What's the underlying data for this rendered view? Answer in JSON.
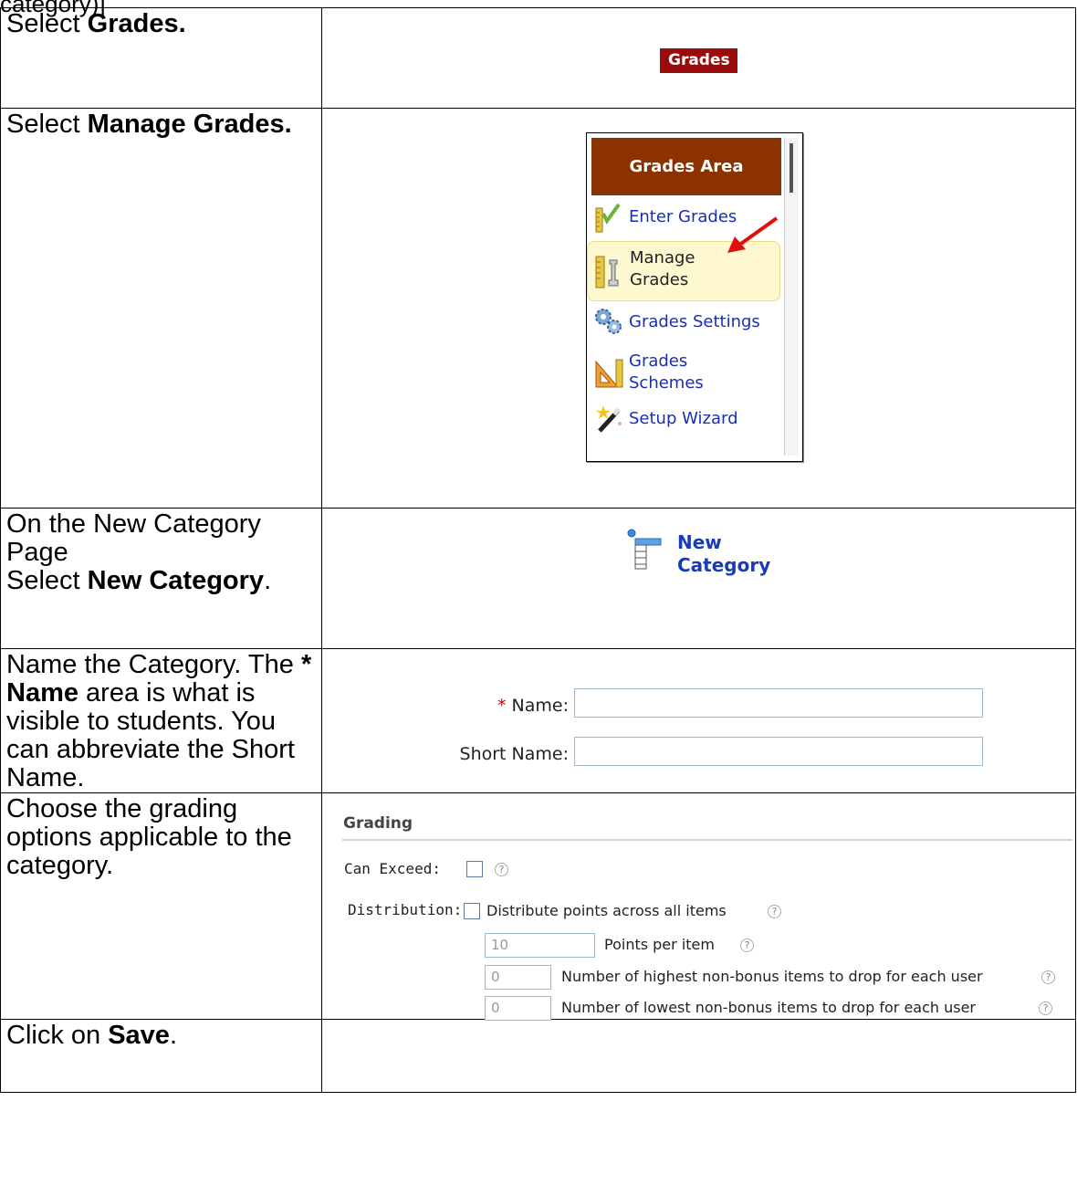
{
  "clipped_text": "category)]",
  "rows": [
    {
      "instruction": [
        "Select ",
        "Grades."
      ]
    },
    {
      "instruction": [
        "Select ",
        "Manage Grades."
      ]
    },
    {
      "instruction": [
        "On the New Category Page",
        "Select ",
        "New Category",
        "."
      ]
    },
    {
      "instruction": [
        "Name the Category. The ",
        "* Name",
        " area is what is visible to students.  You can abbreviate the Short Name."
      ]
    },
    {
      "instruction": [
        "Choose the grading options applicable to the category."
      ]
    },
    {
      "instruction": [
        "Click on ",
        "Save",
        "."
      ]
    }
  ],
  "grades_button": {
    "label": "Grades"
  },
  "grades_menu": {
    "header": "Grades Area",
    "items": [
      {
        "label": "Enter Grades",
        "icon": "ruler-check-icon"
      },
      {
        "label": "Manage Grades",
        "label_lines": [
          "Manage",
          "Grades"
        ],
        "icon": "ruler-tools-icon",
        "highlighted": true
      },
      {
        "label": "Grades Settings",
        "icon": "gears-icon"
      },
      {
        "label": "Grades Schemes",
        "label_lines": [
          "Grades",
          "Schemes"
        ],
        "icon": "triangle-ruler-icon"
      },
      {
        "label": "Setup Wizard",
        "icon": "magic-wand-icon"
      }
    ],
    "colors": {
      "header_bg": "#8b3200",
      "highlight_bg": "#fdf8cf",
      "link": "#1a2fb0"
    }
  },
  "new_category": {
    "label_lines": [
      "New",
      "Category"
    ],
    "icon": "new-category-icon"
  },
  "name_form": {
    "name_required_mark": "*",
    "name_label": "Name:",
    "short_name_label": "Short Name:",
    "name_value": "",
    "short_name_value": ""
  },
  "grading": {
    "title": "Grading",
    "can_exceed_label": "Can Exceed:",
    "can_exceed_checked": false,
    "distribution_label": "Distribution:",
    "distribute_label": "Distribute points across all items",
    "distribute_checked": false,
    "points_per_item_value": "10",
    "points_per_item_label": "Points per item",
    "drop_highest_value": "0",
    "drop_highest_label": "Number of highest non-bonus items to drop for each user",
    "drop_lowest_value": "0",
    "drop_lowest_label": "Number of lowest non-bonus items to drop for each user"
  },
  "colors": {
    "grades_button_bg": "#9a0b0b",
    "required": "#cc0000",
    "new_category_text": "#1a3bb8"
  }
}
